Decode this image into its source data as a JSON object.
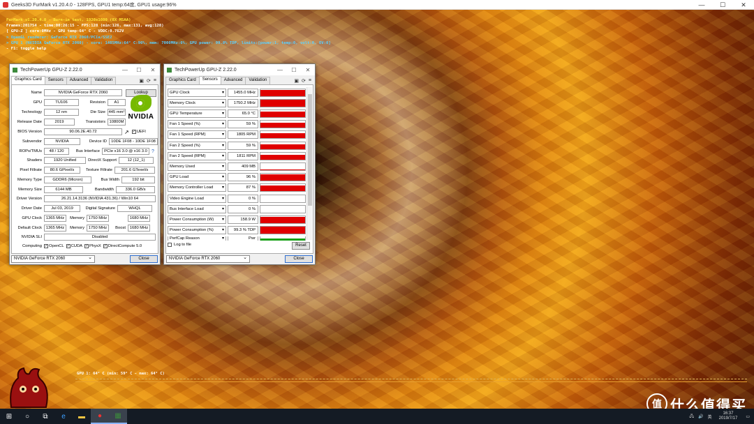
{
  "furmark": {
    "title": "Geeks3D FurMark v1.20.4.0 - 128FPS, GPU1 temp:64度, GPU1 usage:96%",
    "osd": [
      "FurMark v1.20.4.0 - Burn-in test, 1920x1080 (8X MSAA)",
      "Frames:201754 - time:00:26:15 - FPS:128 (min:126, max:131, avg:128)",
      "[ GPU-Z ] core:0MHz - GPU temp:64° C - VDDC:0.762V",
      "> OpenGL renderer: GeForce RTX 2060/PCIe/SSE2",
      "> GPU 1 (NVIDIA GeForce RTX 2060) - core: 1485MHz:64° C:96%, mem: 7000MHz:6%, GPU power: 99.8% TDP, limits:[power:1, temp:0, volt:0, OV:0]",
      "- F1: toggle help"
    ],
    "temp_label": "GPU 1: 64° C (min: 59° C - max: 64° C)"
  },
  "gpuz_left": {
    "title": "TechPowerUp GPU-Z 2.22.0",
    "tabs": [
      "Graphics Card",
      "Sensors",
      "Advanced",
      "Validation"
    ],
    "fields": {
      "name_label": "Name",
      "name": "NVIDIA GeForce RTX 2060",
      "lookup": "Lookup",
      "gpu_label": "GPU",
      "gpu": "TU106",
      "revision_label": "Revision",
      "revision": "A1",
      "technology_label": "Technology",
      "technology": "12 nm",
      "die_size_label": "Die Size",
      "die_size": "445 mm²",
      "release_date_label": "Release Date",
      "release_date": "2019",
      "transistors_label": "Transistors",
      "transistors": "10800M",
      "bios_label": "BIOS Version",
      "bios": "90.06.2E.40.72",
      "uefi": "UEFI",
      "subvendor_label": "Subvendor",
      "subvendor": "NVIDIA",
      "device_id_label": "Device ID",
      "device_id": "10DE 1F08 - 10DE 1F08",
      "rops_label": "ROPs/TMUs",
      "rops": "48 / 120",
      "bus_interface_label": "Bus Interface",
      "bus_interface": "PCIe x16 3.0 @ x16 3.0",
      "help": "?",
      "shaders_label": "Shaders",
      "shaders": "1920 Unified",
      "directx_label": "DirectX Support",
      "directx": "12 (12_1)",
      "pixel_fillrate_label": "Pixel Fillrate",
      "pixel_fillrate": "80.6 GPixel/s",
      "texture_fillrate_label": "Texture Fillrate",
      "texture_fillrate": "201.6 GTexel/s",
      "memory_type_label": "Memory Type",
      "memory_type": "GDDR6 (Micron)",
      "bus_width_label": "Bus Width",
      "bus_width": "192 bit",
      "memory_size_label": "Memory Size",
      "memory_size": "6144 MB",
      "bandwidth_label": "Bandwidth",
      "bandwidth": "336.0 GB/s",
      "driver_version_label": "Driver Version",
      "driver_version": "26.21.14.3136 (NVIDIA 431.36) / Win10 64",
      "driver_date_label": "Driver Date",
      "driver_date": "Jul 03, 2019",
      "digital_signature_label": "Digital Signature",
      "digital_signature": "WHQL",
      "gpu_clock_label": "GPU Clock",
      "gpu_clock": "1365 MHz",
      "memory_label": "Memory",
      "gpu_memory": "1750 MHz",
      "boost_label": "Boost",
      "gpu_boost": "1680 MHz",
      "default_clock_label": "Default Clock",
      "default_clock": "1365 MHz",
      "default_memory": "1750 MHz",
      "default_boost": "1680 MHz",
      "sli_label": "NVIDIA SLI",
      "sli": "Disabled",
      "computing_label": "Computing",
      "opencl": "OpenCL",
      "cuda": "CUDA",
      "physx": "PhysX",
      "directcompute": "DirectCompute 5.0"
    },
    "vendor_logo": "NVIDIA",
    "select": "NVIDIA GeForce RTX 2060",
    "close": "Close"
  },
  "gpuz_right": {
    "title": "TechPowerUp GPU-Z 2.22.0",
    "tabs": [
      "Graphics Card",
      "Sensors",
      "Advanced",
      "Validation"
    ],
    "sensors": [
      {
        "name": "GPU Clock",
        "value": "1455.0 MHz",
        "level": 0.9
      },
      {
        "name": "Memory Clock",
        "value": "1750.2 MHz",
        "level": 0.95
      },
      {
        "name": "GPU Temperature",
        "value": "65.0 °C",
        "level": 0.75
      },
      {
        "name": "Fan 1 Speed (%)",
        "value": "59 %",
        "level": 0.7
      },
      {
        "name": "Fan 1 Speed (RPM)",
        "value": "1805 RPM",
        "level": 0.7
      },
      {
        "name": "Fan 2 Speed (%)",
        "value": "59 %",
        "level": 0.7
      },
      {
        "name": "Fan 2 Speed (RPM)",
        "value": "1811 RPM",
        "level": 0.7
      },
      {
        "name": "Memory Used",
        "value": "409 MB",
        "level": 0.1
      },
      {
        "name": "GPU Load",
        "value": "96 %",
        "level": 0.96
      },
      {
        "name": "Memory Controller Load",
        "value": "87 %",
        "level": 0.87
      },
      {
        "name": "Video Engine Load",
        "value": "0 %",
        "level": 0
      },
      {
        "name": "Bus Interface Load",
        "value": "0 %",
        "level": 0
      },
      {
        "name": "Power Consumption (W)",
        "value": "158.9 W",
        "level": 0.9
      },
      {
        "name": "Power Consumption (%)",
        "value": "99.3 % TDP",
        "level": 0.99
      },
      {
        "name": "PerfCap Reason",
        "value": "Pwr",
        "level": 0.5,
        "color": "#16a016"
      }
    ],
    "log_to_file": "Log to file",
    "reset": "Reset",
    "select": "NVIDIA GeForce RTX 2060",
    "close": "Close"
  },
  "taskbar": {
    "clock_time": "16:37",
    "clock_date": "2019/7/17",
    "ime": "英"
  },
  "watermark": {
    "icon": "值",
    "text": "什么值得买"
  }
}
